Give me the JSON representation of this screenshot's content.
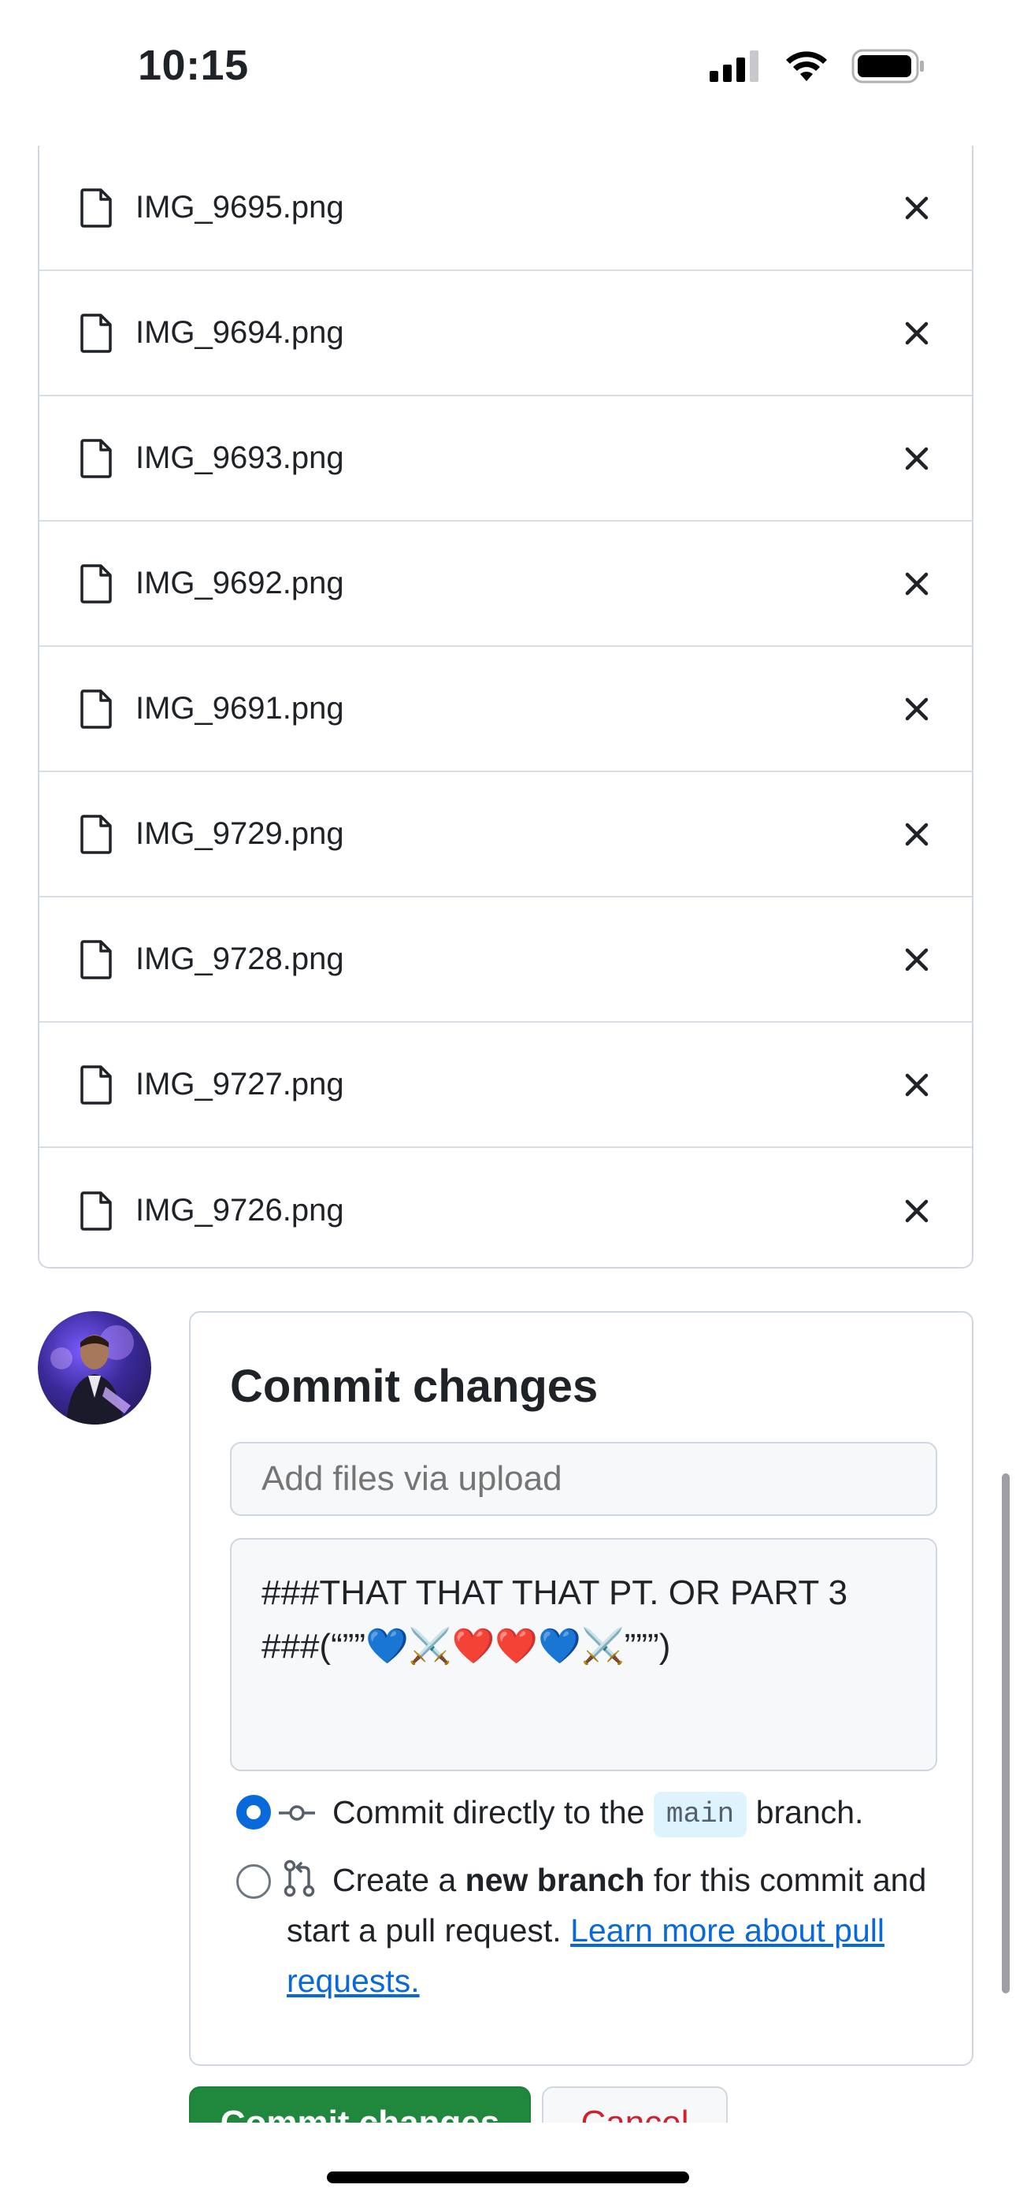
{
  "status_bar": {
    "time": "10:15"
  },
  "files": [
    {
      "name": "IMG_9695.png"
    },
    {
      "name": "IMG_9694.png"
    },
    {
      "name": "IMG_9693.png"
    },
    {
      "name": "IMG_9692.png"
    },
    {
      "name": "IMG_9691.png"
    },
    {
      "name": "IMG_9729.png"
    },
    {
      "name": "IMG_9728.png"
    },
    {
      "name": "IMG_9727.png"
    },
    {
      "name": "IMG_9726.png"
    }
  ],
  "commit": {
    "title": "Commit changes",
    "summary_placeholder": "Add files via upload",
    "description": "###THAT THAT THAT PT. OR PART 3\n###(“””💙⚔️❤️❤️💙⚔️”””)",
    "option_direct_prefix": "Commit directly to the",
    "branch_name": "main",
    "option_direct_suffix": "branch.",
    "option_new_prefix": "Create a",
    "option_new_bold": "new branch",
    "option_new_mid": "for this commit and start a pull request.",
    "learn_more_link": "Learn more about pull requests.",
    "commit_button": "Commit changes",
    "cancel_button": "Cancel"
  },
  "colors": {
    "accent": "#0969da",
    "commit_green": "#1f883d",
    "cancel_red": "#cf222e"
  }
}
